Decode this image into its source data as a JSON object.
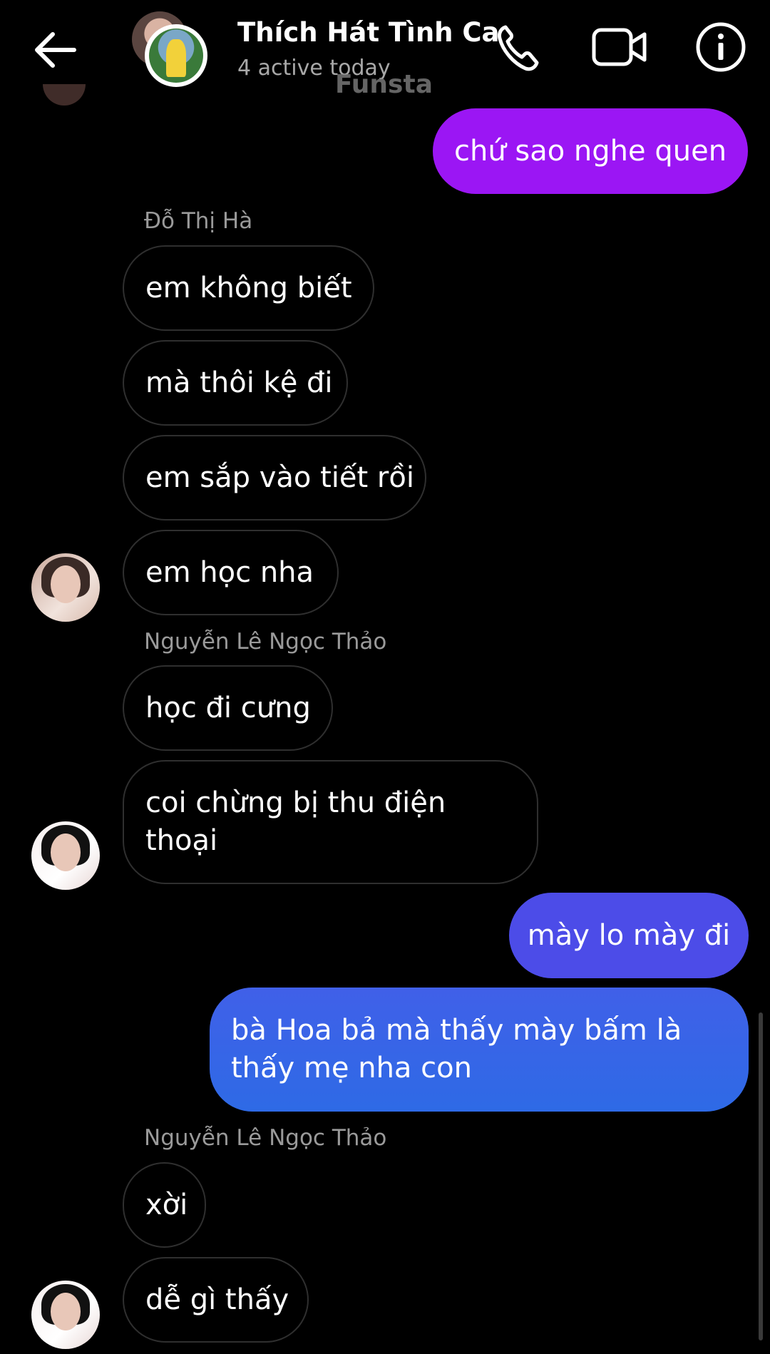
{
  "header": {
    "title": "Thích Hát Tình Ca",
    "status": "4 active today",
    "watermark": "Funsta"
  },
  "colors": {
    "background": "#000000",
    "outgoing_purple": "#9B16F4",
    "outgoing_blue_top": "#4C4CE8",
    "outgoing_blue_bottom": "#2E6AE6",
    "incoming_border": "#2F2F2F",
    "secondary_text": "#9A9A9A"
  },
  "messages": [
    {
      "type": "outgoing",
      "text": "chứ sao nghe quen"
    },
    {
      "type": "sender",
      "text": "Đỗ Thị Hà"
    },
    {
      "type": "incoming",
      "text": "em không biết"
    },
    {
      "type": "incoming",
      "text": "mà thôi kệ đi"
    },
    {
      "type": "incoming",
      "text": "em sắp vào tiết rồi"
    },
    {
      "type": "incoming",
      "text": "em học nha"
    },
    {
      "type": "sender",
      "text": "Nguyễn Lê Ngọc Thảo"
    },
    {
      "type": "incoming",
      "text": "học đi cưng"
    },
    {
      "type": "incoming",
      "text": "coi chừng bị thu điện thoại"
    },
    {
      "type": "outgoing",
      "text": "mày lo mày đi"
    },
    {
      "type": "outgoing",
      "text": "bà Hoa bả mà thấy mày bấm là thấy mẹ nha con"
    },
    {
      "type": "sender",
      "text": "Nguyễn Lê Ngọc Thảo"
    },
    {
      "type": "incoming",
      "text": "xời"
    },
    {
      "type": "incoming",
      "text": "dễ gì thấy"
    }
  ],
  "icons": [
    "back-arrow-icon",
    "phone-icon",
    "video-camera-icon",
    "info-icon"
  ]
}
